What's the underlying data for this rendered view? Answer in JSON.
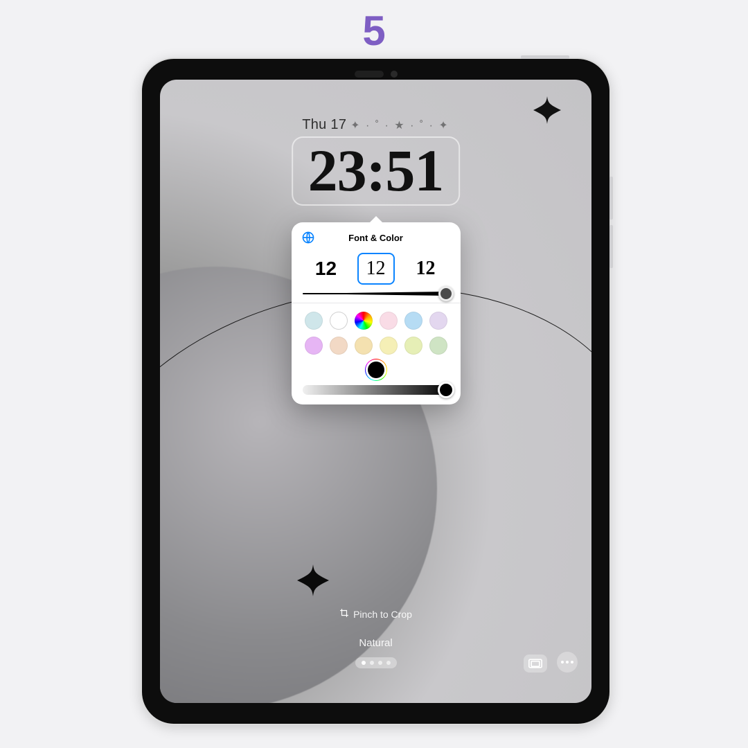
{
  "step_number": "5",
  "lockscreen": {
    "date": "Thu 17",
    "date_deco": "✦ · ˚ · ★ · ˚ · ✦",
    "time": "23:51",
    "hint": "Pinch to Crop",
    "filter": "Natural"
  },
  "popover": {
    "title": "Font & Color",
    "font_samples": [
      "12",
      "12",
      "12"
    ],
    "selected_font_index": 1,
    "weight_slider": 0.98,
    "swatches_row1": [
      "#cfe6ea",
      "#ffffff",
      "rainbow",
      "#f9dce6",
      "#b6dcf4",
      "#e3d7ef"
    ],
    "swatches_row2": [
      "#e6b5f4",
      "#f2d9c5",
      "#f4e1b0",
      "#f5efb6",
      "#e6efb6",
      "#cfe4c4"
    ],
    "tint_slider": 0.98
  }
}
